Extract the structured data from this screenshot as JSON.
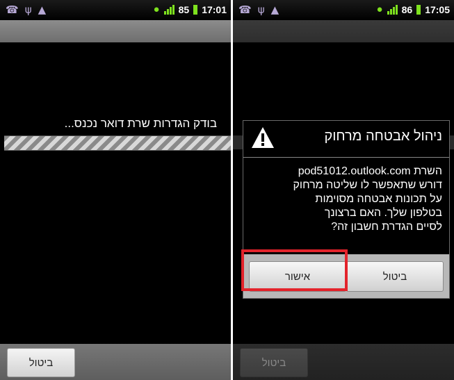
{
  "left_screen": {
    "status_bar": {
      "battery": "85",
      "time": "17:01"
    },
    "status_message": "בודק הגדרות שרת דואר נכנס...",
    "bottom_button": "ביטול"
  },
  "right_screen": {
    "status_bar": {
      "battery": "86",
      "time": "17:05"
    },
    "dialog": {
      "title": "ניהול אבטחה מרחוק",
      "message_lines": [
        "השרת pod51012.outlook.com",
        "דורש שתאפשר לו שליטה מרחוק",
        "על תכונות אבטחה מסוימות",
        "בטלפון שלך. האם ברצונך",
        "לסיים הגדרת חשבון זה?"
      ],
      "ok_button": "אישור",
      "cancel_button": "ביטול"
    },
    "bottom_button": "ביטול"
  },
  "colors": {
    "highlight": "#e3232b",
    "status_green": "#7ee11e"
  },
  "icons": [
    "phone-icon",
    "usb-icon",
    "android-icon",
    "wifi-icon",
    "signal-icon",
    "warning-icon"
  ]
}
